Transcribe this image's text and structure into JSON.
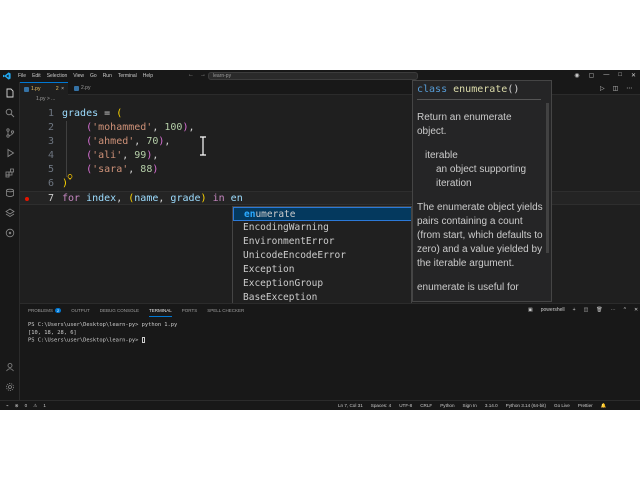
{
  "window": {
    "menu": [
      "File",
      "Edit",
      "Selection",
      "View",
      "Go",
      "Run",
      "Terminal",
      "Help"
    ],
    "search_text": "learn-py"
  },
  "tabs": [
    {
      "label": "1.py",
      "badge": "2"
    },
    {
      "label": "2.py"
    }
  ],
  "breadcrumb": "1.py > ...",
  "editor": {
    "lines": [
      {
        "num": "1",
        "text": "grades = ("
      },
      {
        "num": "2",
        "text": "('mohammed', 100),"
      },
      {
        "num": "3",
        "text": "('ahmed', 70),"
      },
      {
        "num": "4",
        "text": "('ali', 99),"
      },
      {
        "num": "5",
        "text": "('sara', 88)"
      },
      {
        "num": "6",
        "text": ")"
      },
      {
        "num": "7",
        "text": "for index, (name, grade) in en"
      }
    ],
    "current_line": 7,
    "breakpoint_line": 7
  },
  "suggestions": {
    "items": [
      {
        "match": "en",
        "rest": "umerate"
      },
      {
        "match": "",
        "rest": "EncodingWarning"
      },
      {
        "match": "",
        "rest": "EnvironmentError"
      },
      {
        "match": "",
        "rest": "UnicodeEncodeError"
      },
      {
        "match": "",
        "rest": "Exception"
      },
      {
        "match": "",
        "rest": "ExceptionGroup"
      },
      {
        "match": "",
        "rest": "BaseException"
      }
    ],
    "selected_index": 0
  },
  "doc": {
    "sig_kw": "class",
    "sig_name": "enumerate",
    "sig_parens": "()",
    "p1": "Return an enumerate object.",
    "param_name": "iterable",
    "param_desc": "an object supporting iteration",
    "p2": "The enumerate object yields pairs containing a count (from start, which defaults to zero) and a value yielded by the iterable argument.",
    "p3": "enumerate is useful for"
  },
  "panel": {
    "tabs": [
      "PROBLEMS",
      "OUTPUT",
      "DEBUG CONSOLE",
      "TERMINAL",
      "PORTS",
      "SPELL CHECKER"
    ],
    "active_tab": "TERMINAL",
    "problems_count": "2",
    "shell": "powershell",
    "terminal_lines": [
      "PS C:\\Users\\user\\Desktop\\learn-py> python 1.py",
      "[10, 18, 28, 6]",
      "PS C:\\Users\\user\\Desktop\\learn-py> "
    ]
  },
  "status": {
    "errors": "0",
    "warnings": "1",
    "position": "Ln 7, Col 31",
    "spaces": "Spaces: 4",
    "encoding": "UTF-8",
    "eol": "CRLF",
    "language": "Python",
    "signin": "Sign In",
    "version": "3.14.0",
    "interpreter": "Python 3.14 (64-bit)",
    "golive": "Go Live",
    "prettier": "Prettier"
  },
  "colors": {
    "accent": "#0078d4",
    "editor_bg": "#1f1f1f",
    "suggest_highlight": "#2aaaff",
    "breakpoint": "#e51400"
  }
}
